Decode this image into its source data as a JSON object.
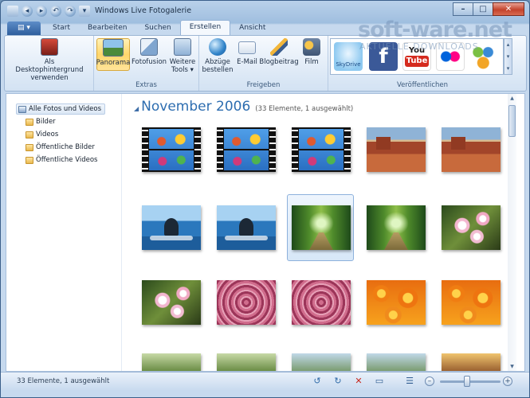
{
  "window": {
    "title": "Windows Live Fotogalerie",
    "app_menu_label": "▤ ▾"
  },
  "tabs": [
    {
      "label": "Start",
      "active": false
    },
    {
      "label": "Bearbeiten",
      "active": false
    },
    {
      "label": "Suchen",
      "active": false
    },
    {
      "label": "Erstellen",
      "active": true
    },
    {
      "label": "Ansicht",
      "active": false
    }
  ],
  "ribbon": {
    "desktop_button_line1": "Als Desktophintergrund",
    "desktop_button_line2": "verwenden",
    "extras": {
      "label": "Extras",
      "panorama": "Panorama",
      "fotofusion": "Fotofusion",
      "weitere_line1": "Weitere",
      "weitere_line2": "Tools ▾"
    },
    "freigeben": {
      "label": "Freigeben",
      "abzuege_line1": "Abzüge",
      "abzuege_line2": "bestellen",
      "email": "E-Mail",
      "blogbeitrag": "Blogbeitrag",
      "film": "Film"
    },
    "veroeffentlichen": {
      "label": "Veröffentlichen",
      "skydrive": "SkyDrive",
      "facebook": "f",
      "youtube_line1": "You",
      "youtube_line2": "Tube"
    }
  },
  "watermark": {
    "main": "soft-ware.net",
    "sub": "AKTUELLE DOWNLOADS"
  },
  "nav": {
    "root": "Alle Fotos und Videos",
    "items": [
      "Bilder",
      "Videos",
      "Öffentliche Bilder",
      "Öffentliche Videos"
    ]
  },
  "gallery": {
    "section_title": "November 2006",
    "section_count": "(33 Elemente, 1 ausgewählt)",
    "thumbnails": [
      {
        "kind": "film",
        "selected": false
      },
      {
        "kind": "film",
        "selected": false
      },
      {
        "kind": "film",
        "selected": false
      },
      {
        "kind": "desert",
        "selected": false
      },
      {
        "kind": "desert",
        "selected": false
      },
      {
        "kind": "whale",
        "selected": false
      },
      {
        "kind": "whale",
        "selected": false
      },
      {
        "kind": "forest",
        "selected": true
      },
      {
        "kind": "forest",
        "selected": false
      },
      {
        "kind": "blossom",
        "selected": false
      },
      {
        "kind": "blossom",
        "selected": false
      },
      {
        "kind": "pinkflower",
        "selected": false
      },
      {
        "kind": "pinkflower",
        "selected": false
      },
      {
        "kind": "orange",
        "selected": false
      },
      {
        "kind": "orange",
        "selected": false
      }
    ]
  },
  "status": {
    "text": "33 Elemente, 1 ausgewählt",
    "zoom_level": 0.45
  },
  "colors": {
    "accent": "#2d6db0",
    "selection": "#ffd66b"
  },
  "icons": {
    "rotate_left": "rotate-left-icon",
    "rotate_right": "rotate-right-icon",
    "delete": "delete-icon",
    "slideshow": "slideshow-icon",
    "details": "details-view-icon"
  }
}
